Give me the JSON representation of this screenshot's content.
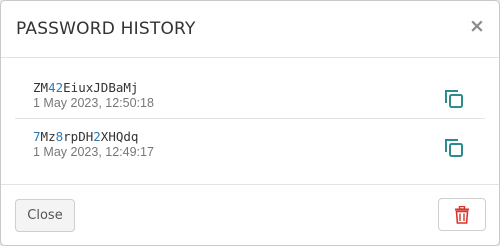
{
  "dialog": {
    "title": "PASSWORD HISTORY",
    "close_icon": "close-icon"
  },
  "entries": [
    {
      "password": "ZM42EiuxJDBaMj",
      "timestamp": "1 May 2023, 12:50:18",
      "copy_icon": "copy-icon"
    },
    {
      "password": "7Mz8rpDH2XHQdq",
      "timestamp": "1 May 2023, 12:49:17",
      "copy_icon": "copy-icon"
    }
  ],
  "footer": {
    "close_label": "Close",
    "delete_icon": "trash-icon"
  },
  "colors": {
    "digit": "#2a7ab8",
    "copy_icon": "#2a8c8c",
    "delete_icon": "#d9342b"
  }
}
